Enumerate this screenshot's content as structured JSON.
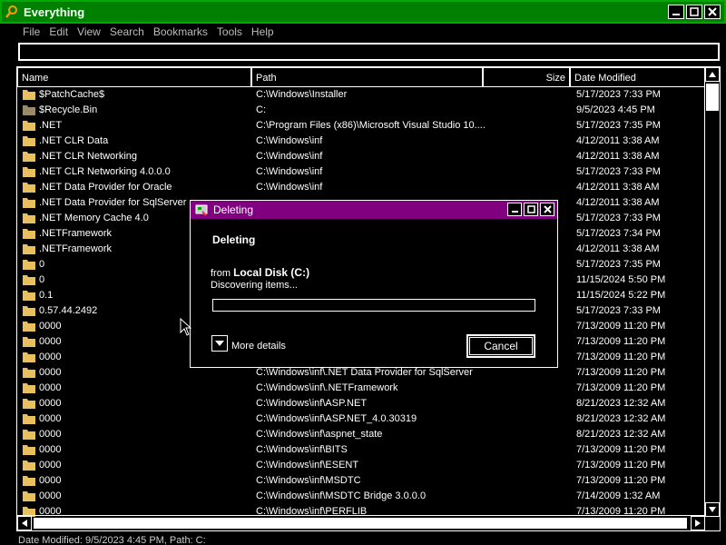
{
  "window": {
    "title": "Everything"
  },
  "menu": [
    "File",
    "Edit",
    "View",
    "Search",
    "Bookmarks",
    "Tools",
    "Help"
  ],
  "search": {
    "value": ""
  },
  "columns": {
    "name": "Name",
    "path": "Path",
    "size": "Size",
    "date": "Date Modified"
  },
  "rows": [
    {
      "name": "$PatchCache$",
      "path": "C:\\Windows\\Installer",
      "date": "5/17/2023 7:33 PM",
      "icon": "folder"
    },
    {
      "name": "$Recycle.Bin",
      "path": "C:",
      "date": "9/5/2023 4:45 PM",
      "icon": "recycle"
    },
    {
      "name": ".NET",
      "path": "C:\\Program Files (x86)\\Microsoft Visual Studio 10....",
      "date": "5/17/2023 7:35 PM",
      "icon": "folder"
    },
    {
      "name": ".NET CLR Data",
      "path": "C:\\Windows\\inf",
      "date": "4/12/2011 3:38 AM",
      "icon": "folder"
    },
    {
      "name": ".NET CLR Networking",
      "path": "C:\\Windows\\inf",
      "date": "4/12/2011 3:38 AM",
      "icon": "folder"
    },
    {
      "name": ".NET CLR Networking 4.0.0.0",
      "path": "C:\\Windows\\inf",
      "date": "5/17/2023 7:33 PM",
      "icon": "folder"
    },
    {
      "name": ".NET Data Provider for Oracle",
      "path": "C:\\Windows\\inf",
      "date": "4/12/2011 3:38 AM",
      "icon": "folder"
    },
    {
      "name": ".NET Data Provider for SqlServer",
      "path": "",
      "date": "4/12/2011 3:38 AM",
      "icon": "folder"
    },
    {
      "name": ".NET Memory Cache 4.0",
      "path": "",
      "date": "5/17/2023 7:33 PM",
      "icon": "folder"
    },
    {
      "name": ".NETFramework",
      "path": "",
      "date": "5/17/2023 7:34 PM",
      "icon": "folder"
    },
    {
      "name": ".NETFramework",
      "path": "",
      "date": "4/12/2011 3:38 AM",
      "icon": "folder"
    },
    {
      "name": "0",
      "path": "",
      "date": "5/17/2023 7:35 PM",
      "icon": "folder"
    },
    {
      "name": "0",
      "path": "",
      "date": "11/15/2024 5:50 PM",
      "icon": "folder"
    },
    {
      "name": "0.1",
      "path": "",
      "date": "11/15/2024 5:22 PM",
      "icon": "folder"
    },
    {
      "name": "0.57.44.2492",
      "path": "",
      "date": "5/17/2023 7:33 PM",
      "icon": "folder"
    },
    {
      "name": "0000",
      "path": "",
      "date": "7/13/2009 11:20 PM",
      "icon": "folder"
    },
    {
      "name": "0000",
      "path": "",
      "date": "7/13/2009 11:20 PM",
      "icon": "folder"
    },
    {
      "name": "0000",
      "path": "",
      "date": "7/13/2009 11:20 PM",
      "icon": "folder"
    },
    {
      "name": "0000",
      "path": "C:\\Windows\\inf\\.NET Data Provider for SqlServer",
      "date": "7/13/2009 11:20 PM",
      "icon": "folder"
    },
    {
      "name": "0000",
      "path": "C:\\Windows\\inf\\.NETFramework",
      "date": "7/13/2009 11:20 PM",
      "icon": "folder"
    },
    {
      "name": "0000",
      "path": "C:\\Windows\\inf\\ASP.NET",
      "date": "8/21/2023 12:32 AM",
      "icon": "folder"
    },
    {
      "name": "0000",
      "path": "C:\\Windows\\inf\\ASP.NET_4.0.30319",
      "date": "8/21/2023 12:32 AM",
      "icon": "folder"
    },
    {
      "name": "0000",
      "path": "C:\\Windows\\inf\\aspnet_state",
      "date": "8/21/2023 12:32 AM",
      "icon": "folder"
    },
    {
      "name": "0000",
      "path": "C:\\Windows\\inf\\BITS",
      "date": "7/13/2009 11:20 PM",
      "icon": "folder"
    },
    {
      "name": "0000",
      "path": "C:\\Windows\\inf\\ESENT",
      "date": "7/13/2009 11:20 PM",
      "icon": "folder"
    },
    {
      "name": "0000",
      "path": "C:\\Windows\\inf\\MSDTC",
      "date": "7/13/2009 11:20 PM",
      "icon": "folder"
    },
    {
      "name": "0000",
      "path": "C:\\Windows\\inf\\MSDTC Bridge 3.0.0.0",
      "date": "7/14/2009 1:32 AM",
      "icon": "folder"
    },
    {
      "name": "0000",
      "path": "C:\\Windows\\inf\\PERFLIB",
      "date": "7/13/2009 11:20 PM",
      "icon": "folder"
    }
  ],
  "status": "Date Modified: 9/5/2023 4:45 PM, Path: C:",
  "dialog": {
    "title": "Deleting",
    "heading": "Deleting",
    "from_prefix": "from",
    "from_location": "Local Disk (C:)",
    "status": "Discovering items...",
    "progress": 0,
    "more_details": "More details",
    "cancel": "Cancel"
  },
  "colors": {
    "titlebar": "#008000",
    "dialog_titlebar": "#800080",
    "folder": "#e8c060",
    "background": "#000000"
  }
}
